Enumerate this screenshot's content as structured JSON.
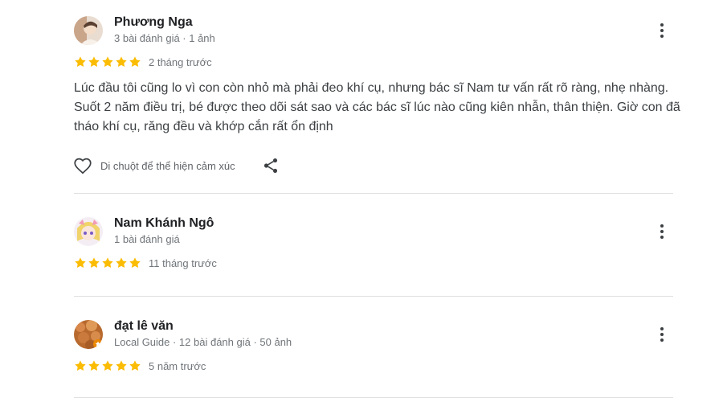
{
  "reviews": [
    {
      "name": "Phương Nga",
      "meta": "3 bài đánh giá · 1 ảnh",
      "rating": 5,
      "age": "2 tháng trước",
      "text": "Lúc đầu tôi cũng lo vì con còn nhỏ mà phải đeo khí cụ, nhưng bác sĩ Nam tư vấn rất rõ ràng, nhẹ nhàng. Suốt 2 năm điều trị, bé được theo dõi sát sao và các bác sĩ lúc nào cũng kiên nhẫn, thân thiện. Giờ con đã tháo khí cụ, răng đều và khớp cắn rất ổn định",
      "react_label": "Di chuột để thể hiện cảm xúc"
    },
    {
      "name": "Nam Khánh Ngô",
      "meta": "1 bài đánh giá",
      "rating": 5,
      "age": "11 tháng trước"
    },
    {
      "name": "đạt lê văn",
      "meta": "Local Guide · 12 bài đánh giá · 50 ảnh",
      "rating": 5,
      "age": "5 năm trước"
    }
  ],
  "icons": {
    "star": "star-icon",
    "more": "more-vert-icon",
    "heart": "heart-outline-icon",
    "share": "share-icon"
  },
  "colors": {
    "star": "#fbbc04",
    "name": "#202124",
    "meta": "#70757a",
    "divider": "#e0e0e0"
  }
}
